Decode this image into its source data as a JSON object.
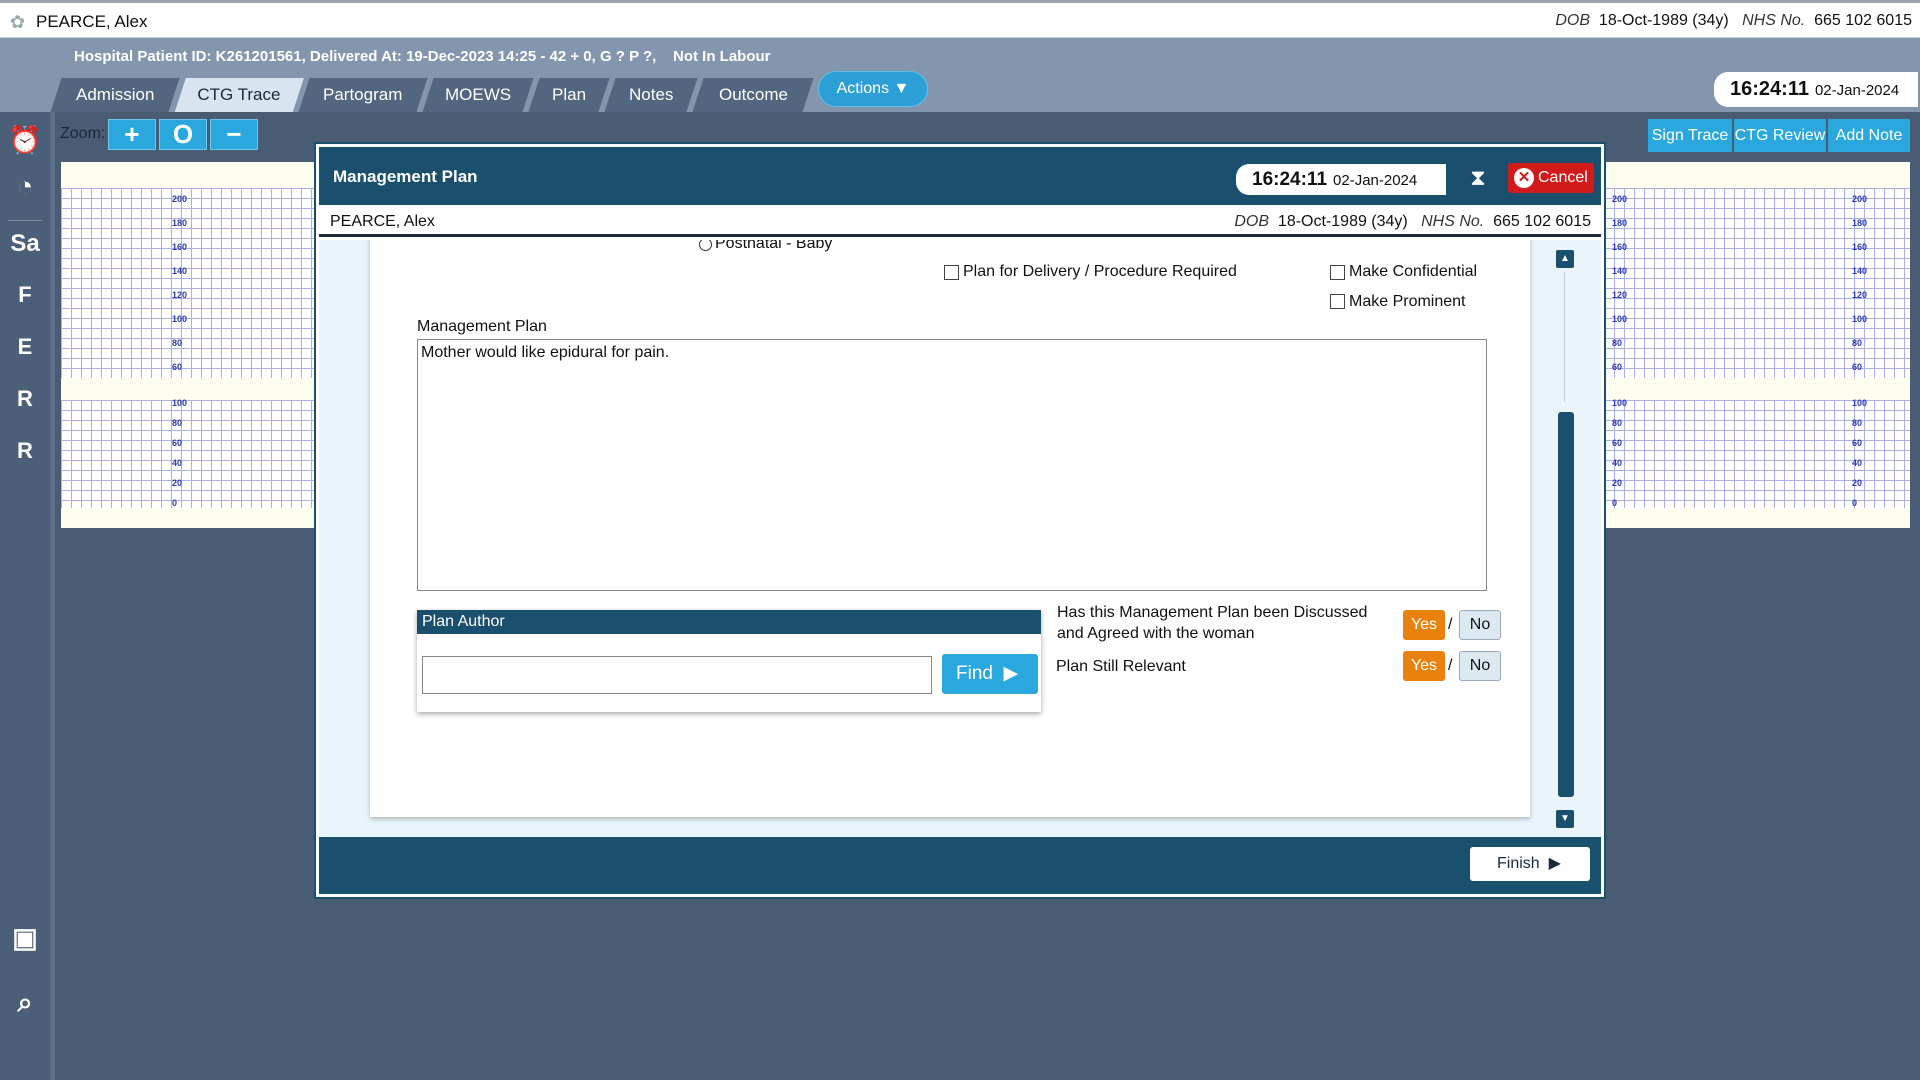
{
  "patient": {
    "name": "PEARCE, Alex",
    "dob_label": "DOB",
    "dob": "18-Oct-1989 (34y)",
    "nhs_label": "NHS No.",
    "nhs": "665 102 6015"
  },
  "hospital_info": "Hospital Patient ID: K261201561, Delivered At: 19-Dec-2023 14:25 - 42 + 0, G ? P ?,    Not In Labour",
  "tabs": [
    {
      "label": "Admission"
    },
    {
      "label": "CTG Trace"
    },
    {
      "label": "Partogram"
    },
    {
      "label": "MOEWS"
    },
    {
      "label": "Plan"
    },
    {
      "label": "Notes"
    },
    {
      "label": "Outcome"
    }
  ],
  "active_tab": "CTG Trace",
  "actions_label": "Actions",
  "clock": {
    "time": "16:24:11",
    "date": "02-Jan-2024"
  },
  "zoom": {
    "label": "Zoom:",
    "plus": "+",
    "reset": "O",
    "minus": "−"
  },
  "right_buttons": [
    "Sign Trace",
    "CTG Review",
    "Add Note"
  ],
  "rail_letters": [
    "Sa",
    "F",
    "E",
    "R",
    "R"
  ],
  "ctg_ticks_top": [
    "200",
    "180",
    "160",
    "140",
    "120",
    "100",
    "80",
    "60"
  ],
  "ctg_ticks_bottom": [
    "100",
    "80",
    "60",
    "40",
    "20",
    "0"
  ],
  "modal": {
    "title": "Management Plan",
    "cancel_label": "Cancel",
    "radio_label": "Postnatal - Baby",
    "plan_delivery_label": "Plan for Delivery / Procedure Required",
    "make_confidential_label": "Make Confidential",
    "make_prominent_label": "Make Prominent",
    "management_plan_label": "Management Plan",
    "management_plan_text": "Mother would like epidural for pain.",
    "plan_author_label": "Plan Author",
    "find_label": "Find",
    "discussed_q1": "Has this Management Plan been Discussed",
    "discussed_q2": "and Agreed with the woman",
    "relevant_label": "Plan Still Relevant",
    "yes_label": "Yes",
    "no_label": "No",
    "slash": "/",
    "discussed_value": "Yes",
    "relevant_value": "Yes",
    "finish_label": "Finish"
  },
  "colors": {
    "header_navy": "#1a4f6d",
    "accent_blue": "#2aa7dc",
    "yes_orange": "#e8820c",
    "cancel_red": "#d11a1a"
  }
}
